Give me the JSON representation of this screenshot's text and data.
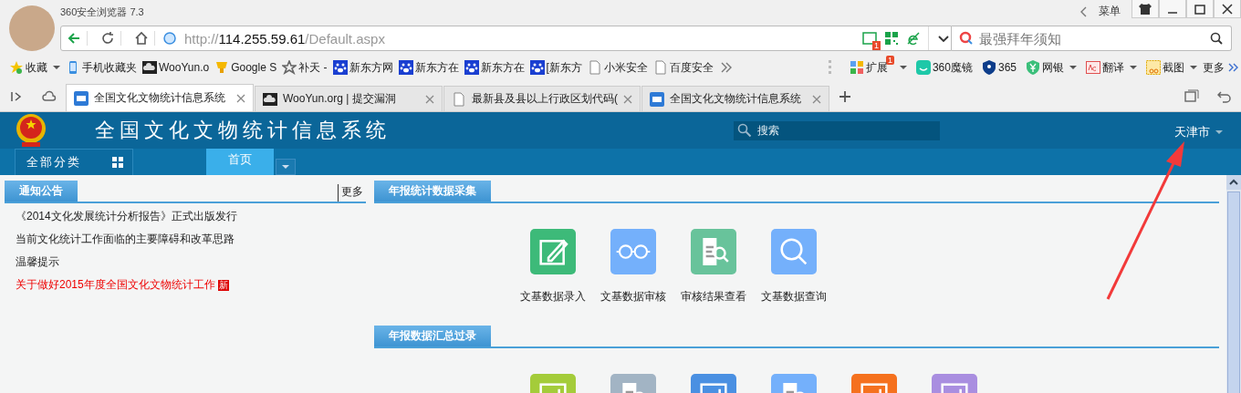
{
  "browser": {
    "title": "360安全浏览器 7.3",
    "menu": "菜单",
    "address": {
      "scheme": "http://",
      "host": "114.255.59.61",
      "path": "/Default.aspx"
    },
    "address_badge": "1",
    "search": {
      "placeholder": "最强拜年须知"
    },
    "bookmarks": [
      {
        "label": "收藏",
        "kind": "star",
        "caret": true
      },
      {
        "label": "手机收藏夹",
        "kind": "phone",
        "caret": false
      },
      {
        "label": "WooYun.o",
        "kind": "cloud",
        "caret": false
      },
      {
        "label": "Google S",
        "kind": "trophy",
        "caret": false
      },
      {
        "label": "补天 -",
        "kind": "star-outline",
        "caret": false
      },
      {
        "label": "新东方网",
        "kind": "paw",
        "caret": false
      },
      {
        "label": "新东方在",
        "kind": "paw",
        "caret": false
      },
      {
        "label": "新东方在",
        "kind": "paw",
        "caret": false
      },
      {
        "label": "[新东方",
        "kind": "paw",
        "caret": false
      },
      {
        "label": "小米安全",
        "kind": "page",
        "caret": false
      },
      {
        "label": "百度安全",
        "kind": "page",
        "caret": false
      }
    ],
    "extensions": [
      {
        "label": "扩展",
        "kind": "grid",
        "caret": true,
        "badge": "1"
      },
      {
        "label": "360魔镜",
        "kind": "face",
        "caret": false
      },
      {
        "label": "365",
        "kind": "shield",
        "caret": false
      },
      {
        "label": "网银",
        "kind": "yen",
        "caret": true
      },
      {
        "label": "翻译",
        "kind": "dict",
        "caret": true
      },
      {
        "label": "截图",
        "kind": "crop",
        "caret": true
      }
    ],
    "more": "更多",
    "tabs": [
      {
        "title": "全国文化文物统计信息系统",
        "kind": "ro",
        "selected": true
      },
      {
        "title": "WooYun.org | 提交漏洞",
        "kind": "cloud",
        "selected": false
      },
      {
        "title": "最新县及县以上行政区划代码(",
        "kind": "page",
        "selected": false
      },
      {
        "title": "全国文化文物统计信息系统",
        "kind": "ro",
        "selected": false
      }
    ]
  },
  "page": {
    "title": "全国文化文物统计信息系统",
    "search": {
      "placeholder": "搜索"
    },
    "city": "天津市",
    "nav": {
      "all_categories": "全部分类",
      "tabs": [
        {
          "label": "首页",
          "selected": true
        }
      ]
    },
    "notices": {
      "title": "通知公告",
      "more": "更多",
      "items": [
        {
          "text": "《2014文化发展统计分析报告》正式出版发行",
          "kind": "normal"
        },
        {
          "text": "当前文化统计工作面临的主要障碍和改革思路",
          "kind": "normal"
        },
        {
          "text": "温馨提示",
          "kind": "normal"
        },
        {
          "text": "关于做好2015年度全国文化文物统计工作",
          "kind": "new",
          "badge": "新"
        }
      ]
    },
    "sections": [
      {
        "title": "年报统计数据采集",
        "items": [
          {
            "label": "文基数据录入",
            "kind": "edit",
            "color": "#3dba79"
          },
          {
            "label": "文基数据审核",
            "kind": "glasses",
            "color": "#74b0fb"
          },
          {
            "label": "审核结果查看",
            "kind": "report",
            "color": "#68c39b"
          },
          {
            "label": "文基数据查询",
            "kind": "search",
            "color": "#74b0fb"
          }
        ]
      },
      {
        "title": "年报数据汇总过录",
        "items": [
          {
            "kind": "chart",
            "color": "#a4cc3a"
          },
          {
            "kind": "report",
            "color": "#a2b4c4"
          },
          {
            "kind": "chart",
            "color": "#4a90e2"
          },
          {
            "kind": "report",
            "color": "#74b0fb"
          },
          {
            "kind": "chart",
            "color": "#f5711e"
          },
          {
            "kind": "chart",
            "color": "#a98ee0"
          }
        ]
      }
    ]
  }
}
